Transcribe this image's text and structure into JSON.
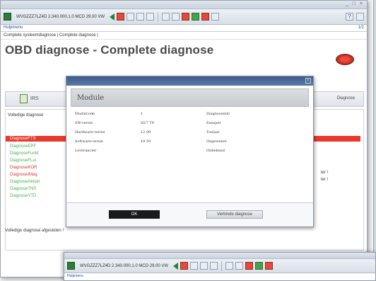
{
  "window": {
    "controls": "_ □ ×"
  },
  "toolbar": {
    "address": "WVGZZZ7LZ4D 2.340.000.1.0 MCD 29.00 VW",
    "help": "?"
  },
  "menubar": {
    "label": "Hulpmenu",
    "page_indicator": "1/2"
  },
  "breadcrumb": "Complete systeemdiagnose  |  Complete diagnose  |",
  "page": {
    "title": "OBD diagnose - Complete diagnose"
  },
  "tabs": {
    "left_label": "IRS",
    "right_label": "Diagnose"
  },
  "list": {
    "header": "Volledige diagnose",
    "items": [
      {
        "label": "DiagnoseFTS",
        "status": "selected"
      },
      {
        "label": "DiagnoseEPF",
        "status": "green"
      },
      {
        "label": "DiagnoseFunkt",
        "status": "green"
      },
      {
        "label": "DiagnoseFLui",
        "status": "green"
      },
      {
        "label": "DiagnoseKOR",
        "status": "red"
      },
      {
        "label": "DiagnoseIMag",
        "status": "red"
      },
      {
        "label": "DiagnoseAktuel",
        "status": "green"
      },
      {
        "label": "DiagnoseTNS",
        "status": "green"
      },
      {
        "label": "DiagnoseYTD",
        "status": "green"
      }
    ],
    "right_notes": [
      "ler !",
      "ler !"
    ],
    "footer": "Volledige diagnose afgesloten !"
  },
  "modal": {
    "heading": "Module",
    "rows": [
      {
        "label": "Modulcode",
        "value": "1",
        "status": "Diagnoseinfo"
      },
      {
        "label": "SW-versie",
        "value": "H17 T9",
        "status": "Eenspel"
      },
      {
        "label": "Hardware-versie",
        "value": "12 99",
        "status": "Toelaat"
      },
      {
        "label": "Software-versie",
        "value": "18 59",
        "status": "Ongewenst"
      },
      {
        "label": "Leverancier",
        "value": "",
        "status": "Onbekend"
      }
    ],
    "ok_label": "OK",
    "save_label": "Verbinde diagnose"
  },
  "colors": {
    "accent": "#e8392b",
    "ok_green": "#4ab04e",
    "error_red": "#d23a2c",
    "title_bar": "#3b5c8a"
  }
}
